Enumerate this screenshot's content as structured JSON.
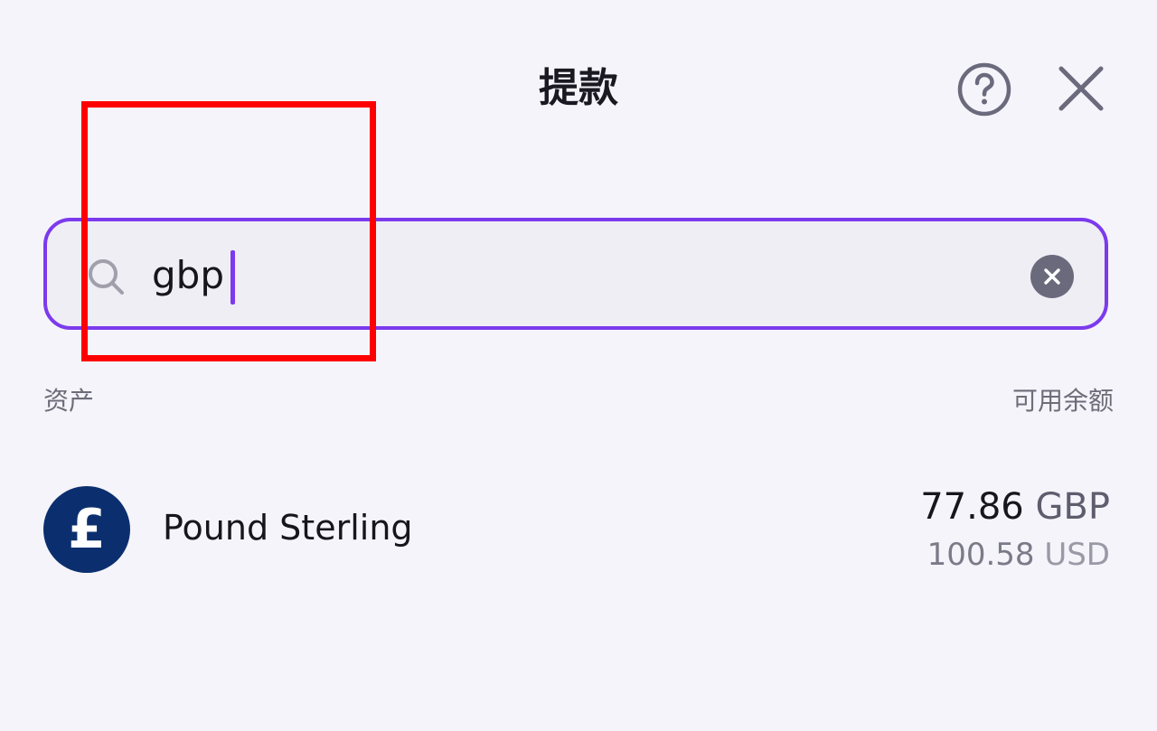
{
  "header": {
    "title": "提款",
    "help_icon": "help-circle-icon",
    "close_icon": "close-icon"
  },
  "search": {
    "value": "gbp",
    "placeholder": "",
    "icon": "search-icon",
    "clear_icon": "clear-circle-icon"
  },
  "columns": {
    "asset": "资产",
    "balance": "可用余额"
  },
  "assets": [
    {
      "icon": "pound-sterling-icon",
      "symbol": "£",
      "name": "Pound Sterling",
      "amount": "77.86",
      "unit": "GBP",
      "fiat_amount": "100.58",
      "fiat_unit": "USD"
    }
  ],
  "colors": {
    "accent": "#7c3aed",
    "background": "#f5f4fa",
    "currency_icon_bg": "#0b2f6e",
    "annotation_box": "#ff0000"
  }
}
